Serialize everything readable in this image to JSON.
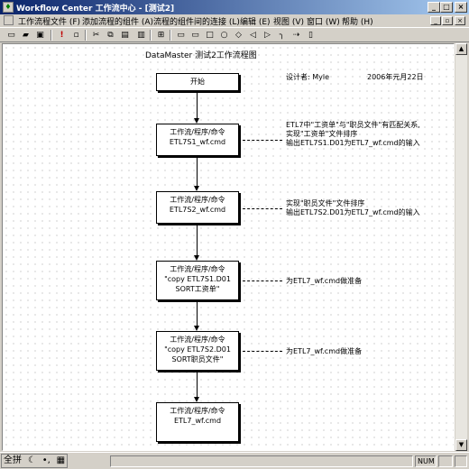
{
  "window": {
    "title": "Workflow Center 工作流中心 - [测试2]",
    "min_glyph": "_",
    "max_glyph": "□",
    "close_glyph": "×"
  },
  "menu": [
    "工作流程文件 (F)",
    "添加流程的组件 (A)",
    "流程的组件间的连接 (L)",
    "编辑 (E)",
    "视图 (V)",
    "窗口 (W)",
    "帮助 (H)"
  ],
  "diagram": {
    "title": "DataMaster 测试2工作流程图",
    "designer": "设计者: Myle",
    "date": "2006年元月22日",
    "start": "开始",
    "nodes": [
      {
        "line1": "工作流/程序/命令",
        "line2": "ETL7S1_wf.cmd",
        "line3": ""
      },
      {
        "line1": "工作流/程序/命令",
        "line2": "ETL7S2_wf.cmd",
        "line3": ""
      },
      {
        "line1": "工作流/程序/命令",
        "line2": "\"copy ETL7S1.D01",
        "line3": "SORT工资单\""
      },
      {
        "line1": "工作流/程序/命令",
        "line2": "\"copy ETL7S2.D01",
        "line3": "SORT职员文件\""
      },
      {
        "line1": "工作流/程序/命令",
        "line2": "ETL7_wf.cmd",
        "line3": ""
      }
    ],
    "notes": [
      {
        "line1": "ETL7中\"工资单\"与\"职员文件\"有匹配关系,",
        "line2": "实现\"工资单\"文件排序",
        "line3": "输出ETL7S1.D01为ETL7_wf.cmd的输入"
      },
      {
        "line1": "实现\"职员文件\"文件排序",
        "line2": "输出ETL7S2.D01为ETL7_wf.cmd的输入",
        "line3": ""
      },
      {
        "line1": "为ETL7_wf.cmd做准备",
        "line2": "",
        "line3": ""
      },
      {
        "line1": "为ETL7_wf.cmd做准备",
        "line2": "",
        "line3": ""
      }
    ]
  },
  "toolbar_icons": [
    "new-icon",
    "open-icon",
    "save-icon",
    "help-icon",
    "cut-icon",
    "copy-icon",
    "paste-icon",
    "print-icon",
    "grid-icon",
    "rounded-rect-icon",
    "rect-icon",
    "box-icon",
    "circle-icon",
    "diamond-icon",
    "left-arrow-icon",
    "right-arrow-icon",
    "connector-icon",
    "flow-icon",
    "label-icon"
  ],
  "taskbar": {
    "ime_label": "全拼",
    "num": "NUM"
  },
  "colors": {
    "titlebar": "#0a246a",
    "chrome": "#d4d0c8"
  }
}
